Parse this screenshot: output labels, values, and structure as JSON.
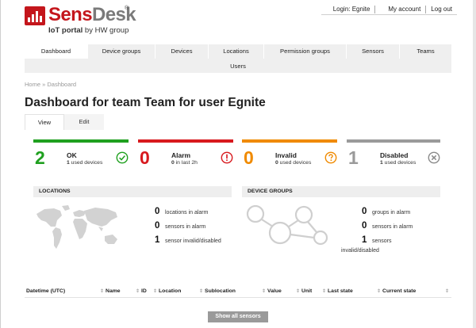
{
  "brand": {
    "name_sens": "Sens",
    "name_desk": "Desk",
    "registered": "®",
    "tagline_bold": "IoT portal",
    "tagline_rest": " by HW group"
  },
  "topnav": {
    "login": "Login: Egnite",
    "account": "My account",
    "logout": "Log out"
  },
  "mainnav": {
    "row1": [
      "Dashboard",
      "Device groups",
      "Devices",
      "Locations",
      "Permission groups",
      "Sensors",
      "Teams"
    ],
    "row2": [
      "Users"
    ],
    "active": "Dashboard"
  },
  "breadcrumb": {
    "home": "Home",
    "sep": " » ",
    "current": "Dashboard"
  },
  "page_title": "Dashboard for team Team for user Egnite",
  "tabs": {
    "view": "View",
    "edit": "Edit"
  },
  "cards": [
    {
      "count": "2",
      "label": "OK",
      "sub_num": "1",
      "sub_text": " used devices",
      "color": "#1fa01f",
      "icon": "check-circle-icon"
    },
    {
      "count": "0",
      "label": "Alarm",
      "sub_num": "0",
      "sub_text": " in last 2h",
      "color": "#d8191e",
      "icon": "exclamation-circle-icon"
    },
    {
      "count": "0",
      "label": "Invalid",
      "sub_num": "0",
      "sub_text": " used devices",
      "color": "#f08a00",
      "icon": "question-circle-icon"
    },
    {
      "count": "1",
      "label": "Disabled",
      "sub_num": "1",
      "sub_text": " used devices",
      "color": "#9a9a9a",
      "icon": "x-circle-icon"
    }
  ],
  "locations": {
    "title": "LOCATIONS",
    "stats": [
      {
        "num": "0",
        "text": "locations in alarm"
      },
      {
        "num": "0",
        "text": "sensors in alarm"
      },
      {
        "num": "1",
        "text": "sensor invalid/disabled"
      }
    ]
  },
  "device_groups": {
    "title": "DEVICE GROUPS",
    "stats": [
      {
        "num": "0",
        "text": "groups in alarm"
      },
      {
        "num": "0",
        "text": "sensors in alarm"
      },
      {
        "num": "1",
        "text": "sensors"
      }
    ],
    "extra": "invalid/disabled"
  },
  "table": {
    "sort_glyph": "⇕",
    "columns": [
      "Datetime (UTC)",
      "Name",
      "ID",
      "Location",
      "Sublocation",
      "Value",
      "Unit",
      "Last state",
      "Current state"
    ]
  },
  "show_all_label": "Show all sensors"
}
